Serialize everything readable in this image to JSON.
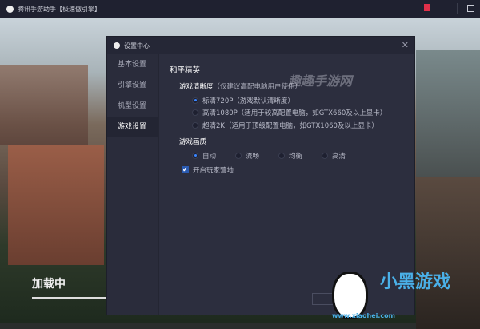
{
  "app": {
    "title": "腾讯手游助手【极速傲引擎】"
  },
  "dialog": {
    "title": "设置中心",
    "sidebar": [
      "基本设置",
      "引擎设置",
      "机型设置",
      "游戏设置"
    ],
    "game": "和平精英",
    "resolution": {
      "label": "游戏清晰度",
      "note": "（仅建议高配电脑用户使用）",
      "options": [
        "标清720P（游戏默认清晰度）",
        "高清1080P（适用于较高配置电脑，如GTX660及以上显卡）",
        "超清2K（适用于顶级配置电脑，如GTX1060及以上显卡）"
      ],
      "selected": 0
    },
    "quality": {
      "label": "游戏画质",
      "options": [
        "自动",
        "流畅",
        "均衡",
        "高清"
      ],
      "selected": 0
    },
    "checkbox": {
      "label": "开启玩家营地",
      "checked": true
    }
  },
  "loading": "加载中",
  "watermarks": {
    "top": "趣趣手游网",
    "bottom": "小黑游戏",
    "url": "www.xiaohei.com"
  }
}
